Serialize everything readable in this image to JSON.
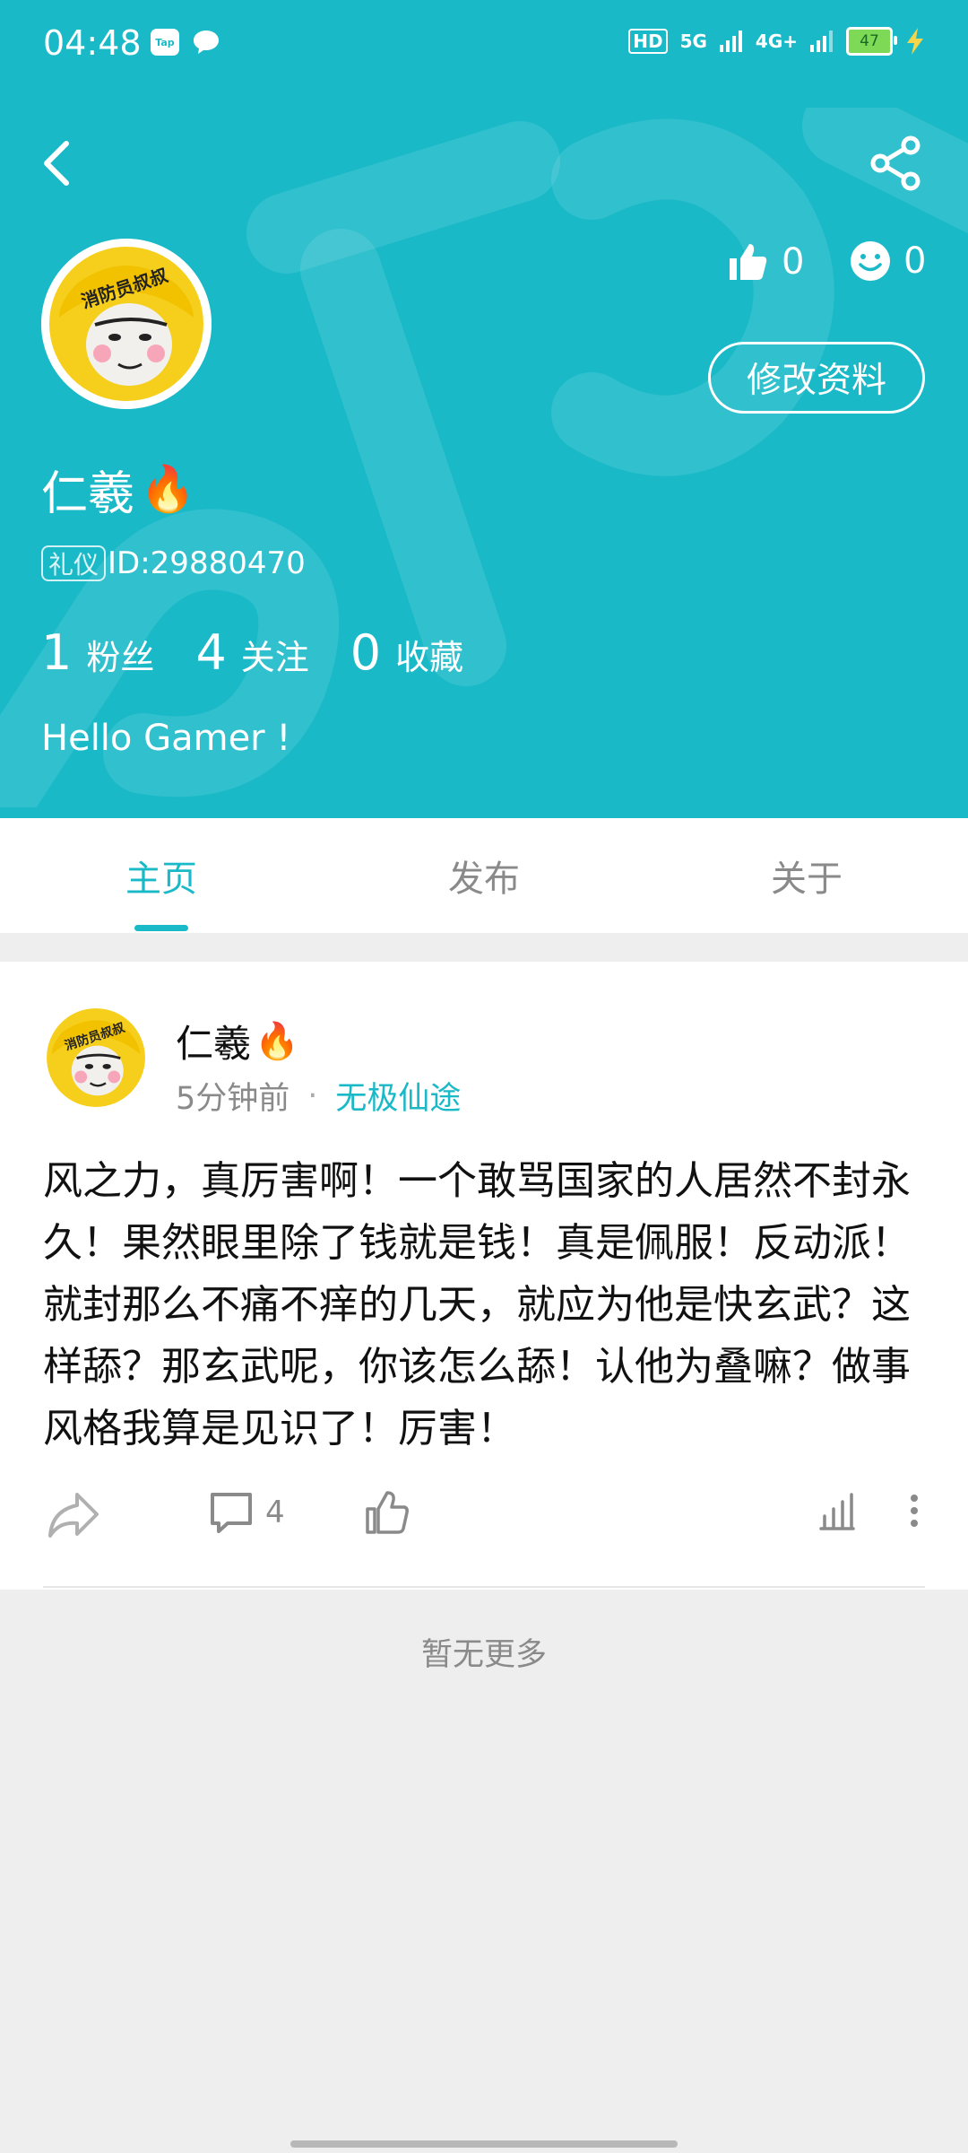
{
  "status_bar": {
    "time": "04:48",
    "tap_label": "Tap",
    "hd_label": "HD",
    "net1": "5G",
    "net2": "4G+",
    "battery": "47"
  },
  "profile": {
    "name": "仁羲",
    "fire_emoji": "🔥",
    "badge": "礼仪",
    "id_text": "ID:29880470",
    "likes": "0",
    "smiles": "0",
    "edit_label": "修改资料",
    "avatar_text": "消防员叔叔",
    "fans_count": "1",
    "fans_label": "粉丝",
    "follow_count": "4",
    "follow_label": "关注",
    "collect_count": "0",
    "collect_label": "收藏",
    "bio": "Hello Gamer !"
  },
  "tabs": [
    {
      "label": "主页",
      "active": true
    },
    {
      "label": "发布",
      "active": false
    },
    {
      "label": "关于",
      "active": false
    }
  ],
  "post": {
    "author": "仁羲",
    "time": "5分钟前",
    "separator": "·",
    "game": "无极仙途",
    "body": "风之力，真厉害啊！一个敢骂国家的人居然不封永久！果然眼里除了钱就是钱！真是佩服！反动派！就封那么不痛不痒的几天，就应为他是快玄武？这样舔？那玄武呢，你该怎么舔！认他为叠嘛？做事风格我算是见识了！厉害！",
    "comment_count": "4"
  },
  "footer": {
    "no_more": "暂无更多"
  },
  "icons": {
    "back": "back-arrow-icon",
    "share": "share-icon",
    "like": "thumbs-up-icon",
    "smile": "smile-icon",
    "forward": "forward-icon",
    "comment": "comment-icon",
    "stats": "stats-icon",
    "more": "more-vertical-icon"
  },
  "colors": {
    "brand": "#1ab9c8",
    "background": "#eeeeee"
  }
}
